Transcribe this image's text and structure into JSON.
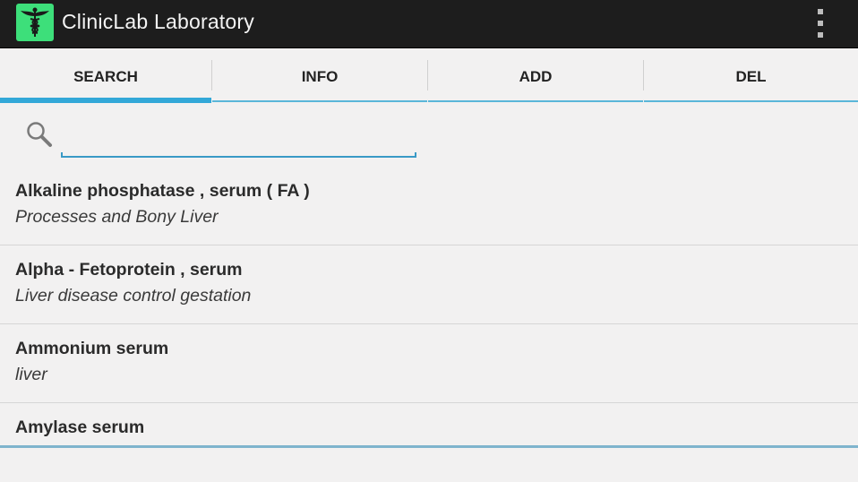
{
  "action_bar": {
    "title": "ClinicLab Laboratory",
    "app_icon": "caduceus-icon",
    "overflow_icon": "overflow-menu-icon"
  },
  "tabs": [
    {
      "label": "SEARCH",
      "selected": true
    },
    {
      "label": "INFO",
      "selected": false
    },
    {
      "label": "ADD",
      "selected": false
    },
    {
      "label": "DEL",
      "selected": false
    }
  ],
  "search": {
    "icon": "search-icon",
    "value": "",
    "placeholder": ""
  },
  "results": [
    {
      "title": "Alkaline phosphatase , serum ( FA )",
      "subtitle": "Processes and Bony Liver"
    },
    {
      "title": "Alpha - Fetoprotein , serum",
      "subtitle": "Liver disease control gestation"
    },
    {
      "title": "Ammonium serum",
      "subtitle": "liver"
    },
    {
      "title": "Amylase serum",
      "subtitle": ""
    }
  ],
  "colors": {
    "action_bar": "#1d1d1d",
    "app_icon_bg": "#3ddf7a",
    "tab_indicator": "#33a8d8",
    "background": "#f2f1f1"
  }
}
